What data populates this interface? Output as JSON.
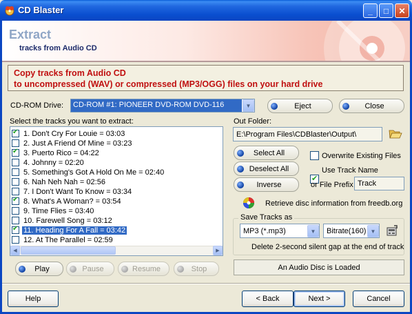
{
  "window": {
    "title": "CD Blaster"
  },
  "banner": {
    "title": "Extract",
    "subtitle": "tracks from Audio CD"
  },
  "description": {
    "line1": "Copy tracks from Audio CD",
    "line2": "to uncompressed (WAV) or compressed (MP3/OGG) files on your hard drive"
  },
  "cdrom": {
    "label": "CD-ROM Drive:",
    "value": "CD-ROM #1: PIONEER  DVD-ROM DVD-116",
    "eject_label": "Eject",
    "close_label": "Close"
  },
  "tracks": {
    "label": "Select the tracks you want to extract:",
    "items": [
      {
        "text": "1. Don't Cry For Louie = 03:03",
        "checked": true
      },
      {
        "text": "2. Just A Friend Of Mine = 03:23",
        "checked": false
      },
      {
        "text": "3. Puerto Rico = 04:22",
        "checked": true
      },
      {
        "text": "4. Johnny = 02:20",
        "checked": false
      },
      {
        "text": "5. Something's Got A Hold On Me = 02:40",
        "checked": false
      },
      {
        "text": "6. Nah Neh Nah = 02:56",
        "checked": false
      },
      {
        "text": "7. I Don't Want To Know = 03:34",
        "checked": false
      },
      {
        "text": "8. What's A Woman? = 03:54",
        "checked": true
      },
      {
        "text": "9. Time Flies = 03:40",
        "checked": false
      },
      {
        "text": "10. Farewell Song = 03:12",
        "checked": false
      },
      {
        "text": "11. Heading For A Fall = 03:42",
        "checked": true,
        "selected": true
      },
      {
        "text": "12. At The Parallel = 02:59",
        "checked": false
      }
    ]
  },
  "playback": {
    "play_label": "Play",
    "pause_label": "Pause",
    "resume_label": "Resume",
    "stop_label": "Stop"
  },
  "output": {
    "folder_label": "Out Folder:",
    "folder_value": "E:\\Program Files\\CDBlaster\\Output\\",
    "select_all_label": "Select All",
    "deselect_all_label": "Deselect All",
    "inverse_label": "Inverse",
    "overwrite_label": "Overwrite Existing Files",
    "overwrite_checked": false,
    "use_track_name_label": "Use Track Name",
    "use_track_name_checked": true,
    "prefix_label": "or File Prefix",
    "prefix_value": "Track",
    "freedb_label": "Retrieve disc information from freedb.org"
  },
  "save_tracks": {
    "legend": "Save Tracks as",
    "format_value": "MP3 (*.mp3)",
    "bitrate_value": "Bitrate(160)",
    "gap_label": "Delete 2-second silent gap at the end of track",
    "gap_checked": true
  },
  "status": {
    "text": "An Audio Disc is Loaded"
  },
  "footer": {
    "help_label": "Help",
    "back_label": "< Back",
    "next_label": "Next >",
    "cancel_label": "Cancel"
  },
  "icons": {
    "app": "cd-blaster-app-icon",
    "folder": "open-folder-icon",
    "freedb": "color-disc-icon",
    "settings": "bitrate-settings-icon"
  },
  "colors": {
    "accent": "#316ac5",
    "description_text": "#c01010",
    "title_bar": "#0a4fd0"
  }
}
